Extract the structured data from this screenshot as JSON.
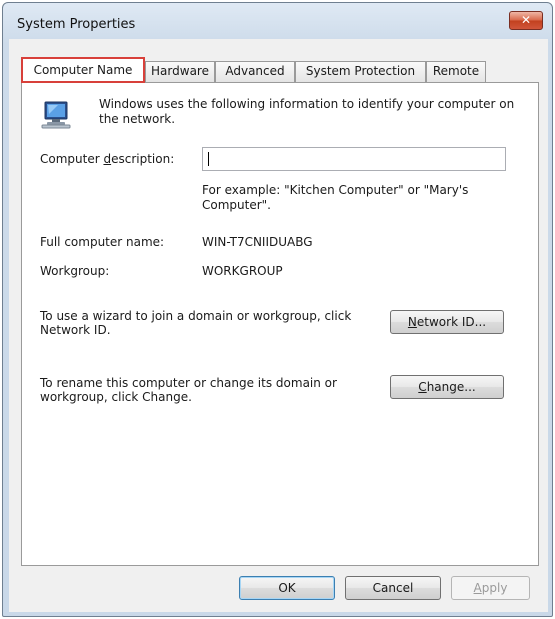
{
  "window": {
    "title": "System Properties",
    "close_glyph": "✕"
  },
  "tabs": [
    {
      "label": "Computer Name",
      "active": true
    },
    {
      "label": "Hardware",
      "active": false
    },
    {
      "label": "Advanced",
      "active": false
    },
    {
      "label": "System Protection",
      "active": false
    },
    {
      "label": "Remote",
      "active": false
    }
  ],
  "computer_name_tab": {
    "icon": "computer-icon",
    "intro_text": "Windows uses the following information to identify your computer on the network.",
    "description_label": "Computer description:",
    "description_value": "",
    "example_text": "For example: \"Kitchen Computer\" or \"Mary's Computer\".",
    "full_name_label": "Full computer name:",
    "full_name_value": "WIN-T7CNIIDUABG",
    "workgroup_label": "Workgroup:",
    "workgroup_value": "WORKGROUP",
    "network_id_text": "To use a wizard to join a domain or workgroup, click Network ID.",
    "network_id_button": "Network ID...",
    "rename_text": "To rename this computer or change its domain or workgroup, click Change.",
    "change_button": "Change..."
  },
  "footer": {
    "ok": "OK",
    "cancel": "Cancel",
    "apply": "Apply"
  },
  "colors": {
    "highlight_border": "#d8403a",
    "close_button": "#c2411f"
  }
}
